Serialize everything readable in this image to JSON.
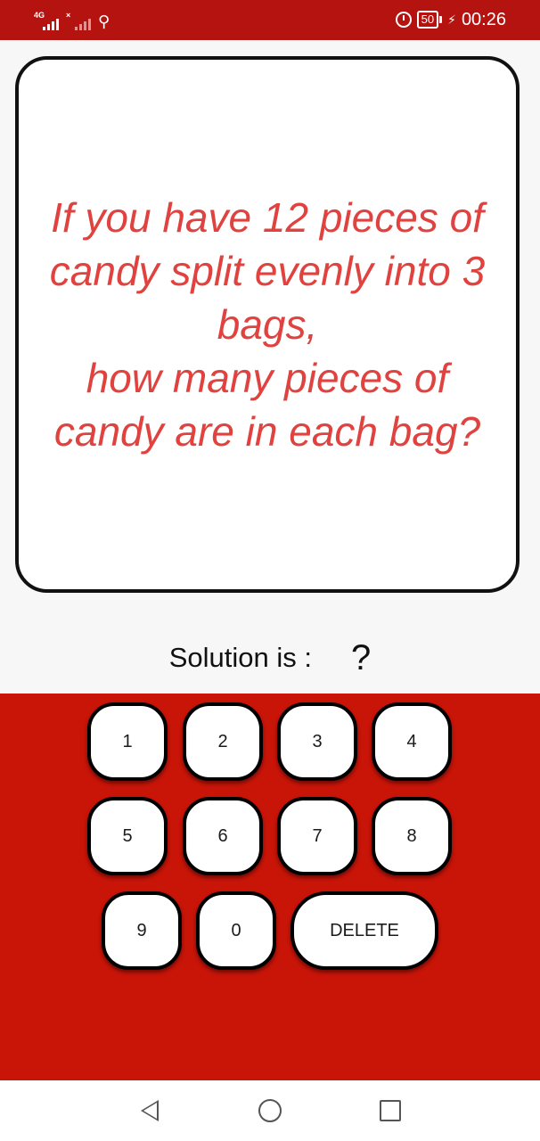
{
  "status_bar": {
    "network_type": "4G",
    "time": "00:26",
    "battery_level": "50",
    "icons": [
      "signal-icon",
      "no-signal-icon",
      "usb-icon",
      "alarm-icon",
      "battery-icon",
      "charging-icon"
    ]
  },
  "question": {
    "text": "If you have 12 pieces of candy split evenly into 3 bags,\n how many pieces of candy are in each bag?"
  },
  "solution": {
    "label": "Solution is :",
    "value": "?"
  },
  "keypad": {
    "keys": [
      "1",
      "2",
      "3",
      "4",
      "5",
      "6",
      "7",
      "8",
      "9",
      "0"
    ],
    "delete_label": "DELETE"
  },
  "nav": {
    "icons": [
      "back-icon",
      "home-icon",
      "recents-icon"
    ]
  },
  "colors": {
    "status_bar": "#b51310",
    "keypad_background": "#c91408",
    "question_text": "#e0433f",
    "page_background": "#f7f7f7"
  }
}
